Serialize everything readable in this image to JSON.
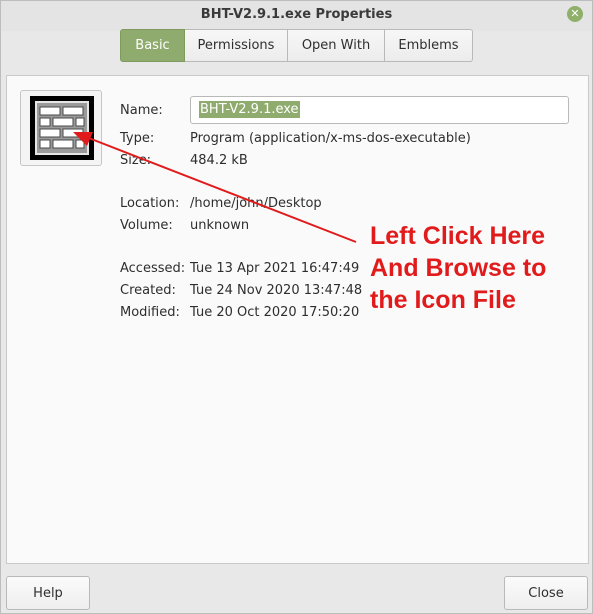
{
  "window": {
    "title": "BHT-V2.9.1.exe Properties"
  },
  "tabs": [
    {
      "label": "Basic",
      "active": true
    },
    {
      "label": "Permissions",
      "active": false
    },
    {
      "label": "Open With",
      "active": false
    },
    {
      "label": "Emblems",
      "active": false
    }
  ],
  "file": {
    "icon": "brick-wall-icon",
    "name_label": "Name:",
    "name_value": "BHT-V2.9.1.exe",
    "type_label": "Type:",
    "type_value": "Program (application/x-ms-dos-executable)",
    "size_label": "Size:",
    "size_value": "484.2 kB",
    "location_label": "Location:",
    "location_value": "/home/john/Desktop",
    "volume_label": "Volume:",
    "volume_value": "unknown",
    "accessed_label": "Accessed:",
    "accessed_value": "Tue 13 Apr 2021 16:47:49",
    "created_label": "Created:",
    "created_value": "Tue 24 Nov 2020 13:47:48",
    "modified_label": "Modified:",
    "modified_value": "Tue 20 Oct 2020 17:50:20"
  },
  "annotation": {
    "line1": "Left Click Here",
    "line2": "And Browse to",
    "line3": "the Icon File",
    "color": "#e11b1b"
  },
  "footer": {
    "help_label": "Help",
    "close_label": "Close"
  },
  "colors": {
    "accent": "#8fab6e"
  }
}
